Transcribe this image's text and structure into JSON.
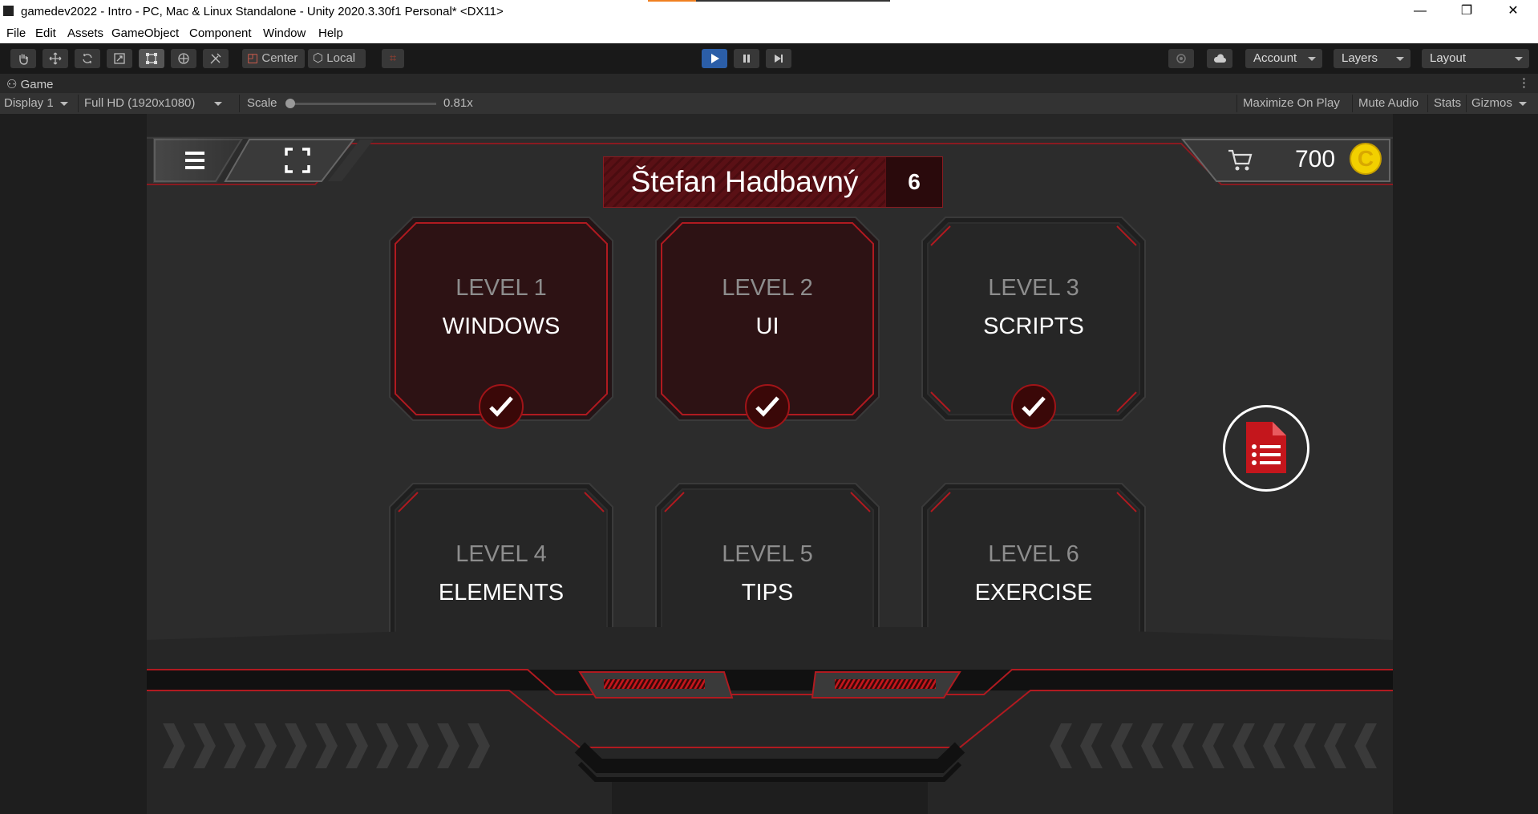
{
  "window": {
    "title": "gamedev2022 - Intro - PC, Mac & Linux Standalone - Unity 2020.3.30f1 Personal* <DX11>",
    "minimize": "—",
    "maximize": "❐",
    "close": "✕",
    "load_progress": 0.2
  },
  "menu": [
    "File",
    "Edit",
    "Assets",
    "GameObject",
    "Component",
    "Window",
    "Help"
  ],
  "toolbar": {
    "tools": [
      "hand-tool-icon",
      "move-tool-icon",
      "rotate-tool-icon",
      "scale-tool-icon",
      "rect-tool-icon",
      "transform-tool-icon",
      "custom-tool-icon"
    ],
    "pivot": "Center",
    "space": "Local",
    "account": "Account",
    "layers": "Layers",
    "layout": "Layout"
  },
  "game_tab": {
    "label": "Game",
    "display": "Display 1",
    "resolution": "Full HD (1920x1080)",
    "scale_label": "Scale",
    "scale_value": "0.81x",
    "maximize_on_play": "Maximize On Play",
    "mute_audio": "Mute Audio",
    "stats": "Stats",
    "gizmos": "Gizmos"
  },
  "game": {
    "player_name": "Štefan Hadbavný",
    "player_number": "6",
    "coins": "700",
    "coin_icon": "C",
    "accent_color": "#d01820",
    "levels": [
      {
        "level": "LEVEL 1",
        "name": "WINDOWS",
        "completed": true,
        "highlighted": true
      },
      {
        "level": "LEVEL 2",
        "name": "UI",
        "completed": true,
        "highlighted": true
      },
      {
        "level": "LEVEL 3",
        "name": "SCRIPTS",
        "completed": true,
        "highlighted": false
      },
      {
        "level": "LEVEL 4",
        "name": "ELEMENTS",
        "completed": true,
        "highlighted": false
      },
      {
        "level": "LEVEL 5",
        "name": "TIPS",
        "completed": true,
        "highlighted": false
      },
      {
        "level": "LEVEL 6",
        "name": "EXERCISE",
        "completed": true,
        "highlighted": false
      }
    ]
  }
}
